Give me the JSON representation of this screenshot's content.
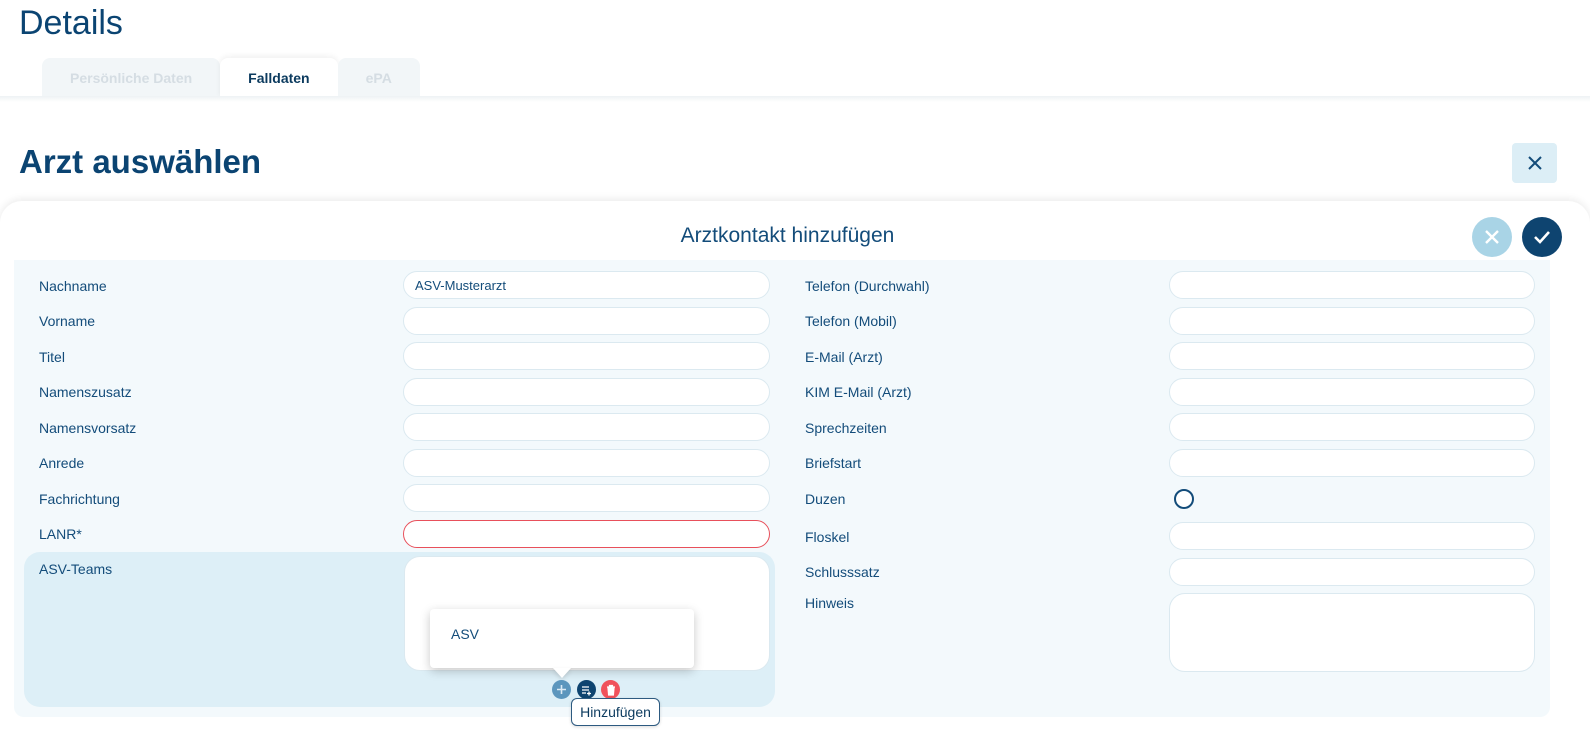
{
  "page": {
    "title": "Details",
    "tabs": [
      {
        "label": "Persönliche Daten",
        "active": false
      },
      {
        "label": "Falldaten",
        "active": true
      },
      {
        "label": "ePA",
        "active": false
      }
    ]
  },
  "modal": {
    "title": "Arzt auswählen",
    "close_icon": "close-icon"
  },
  "form": {
    "title": "Arztkontakt hinzufügen",
    "left_fields": [
      {
        "label": "Nachname",
        "value": "ASV-Musterarzt"
      },
      {
        "label": "Vorname",
        "value": ""
      },
      {
        "label": "Titel",
        "value": ""
      },
      {
        "label": "Namenszusatz",
        "value": ""
      },
      {
        "label": "Namensvorsatz",
        "value": ""
      },
      {
        "label": "Anrede",
        "value": ""
      },
      {
        "label": "Fachrichtung",
        "value": ""
      },
      {
        "label": "LANR*",
        "value": "",
        "error": true
      }
    ],
    "asv_teams": {
      "label": "ASV-Teams",
      "dropdown_options": [
        "ASV"
      ],
      "tooltip": "Hinzufügen"
    },
    "right_fields": [
      {
        "label": "Telefon (Durchwahl)",
        "value": ""
      },
      {
        "label": "Telefon (Mobil)",
        "value": ""
      },
      {
        "label": "E-Mail (Arzt)",
        "value": ""
      },
      {
        "label": "KIM E-Mail (Arzt)",
        "value": ""
      },
      {
        "label": "Sprechzeiten",
        "value": ""
      },
      {
        "label": "Briefstart",
        "value": ""
      },
      {
        "label": "Duzen",
        "value": "",
        "type": "radio",
        "checked": false
      },
      {
        "label": "Floskel",
        "value": ""
      },
      {
        "label": "Schlusssatz",
        "value": ""
      },
      {
        "label": "Hinweis",
        "value": "",
        "type": "textarea"
      }
    ]
  },
  "colors": {
    "primary": "#0e4470",
    "accent_light": "#a9d4e6",
    "error": "#e8505b",
    "delete": "#f0525c"
  }
}
